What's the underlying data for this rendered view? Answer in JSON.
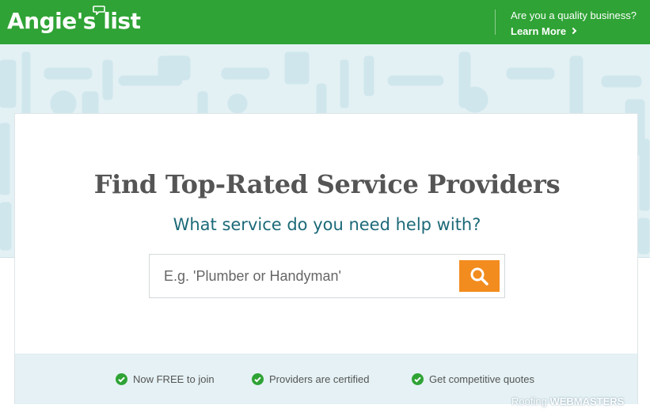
{
  "header": {
    "logo_text": "Angie's list",
    "business_question": "Are you a quality business?",
    "learn_more_label": "Learn More"
  },
  "search": {
    "title": "Find Top-Rated Service Providers",
    "subtitle": "What service do you need help with?",
    "placeholder": "E.g. 'Plumber or Handyman'",
    "value": ""
  },
  "benefits": [
    {
      "label": "Now FREE to join"
    },
    {
      "label": "Providers are certified"
    },
    {
      "label": "Get competitive quotes"
    }
  ],
  "watermark": {
    "part1": "Roofing",
    "part2": "WEBMASTERS"
  },
  "colors": {
    "brand_green": "#2fa335",
    "accent_orange": "#f28c1f",
    "subtitle_teal": "#1c6a78",
    "check_green": "#2fa335",
    "hero_bg": "#e3f1f4"
  },
  "icons": {
    "search_button": "search-icon",
    "benefit_marker": "check-circle-icon",
    "learn_more": "chevron-right-icon"
  }
}
